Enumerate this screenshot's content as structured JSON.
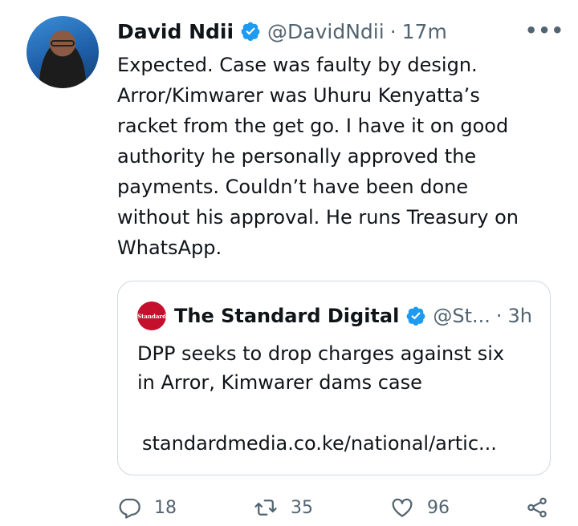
{
  "tweet": {
    "author_name": "David Ndii",
    "handle": "@DavidNdii",
    "separator": "·",
    "time": "17m",
    "more_label": "•••",
    "text": "Expected. Case was faulty by design.\nArror/Kimwarer was Uhuru Kenyatta’s\nracket from the get go. I have it on good\nauthority he personally approved the\npayments. Couldn’t have been done\nwithout his approval. He runs Treasury on\nWhatsApp."
  },
  "quote": {
    "avatar_text": "Standard",
    "author_name": "The Standard Digital",
    "handle": "@St...",
    "separator": "·",
    "time": "3h",
    "text": "DPP seeks to drop charges against six\nin Arror, Kimwarer dams case",
    "link": "standardmedia.co.ke/national/artic..."
  },
  "actions": {
    "reply_count": "18",
    "retweet_count": "35",
    "like_count": "96"
  },
  "colors": {
    "verified": "#1d9bf0",
    "secondary_text": "#536471",
    "border": "#cfd9de",
    "standard_brand": "#c4102c"
  },
  "icons": [
    "verified-badge-icon",
    "more-icon",
    "reply-icon",
    "retweet-icon",
    "like-icon",
    "share-icon"
  ]
}
